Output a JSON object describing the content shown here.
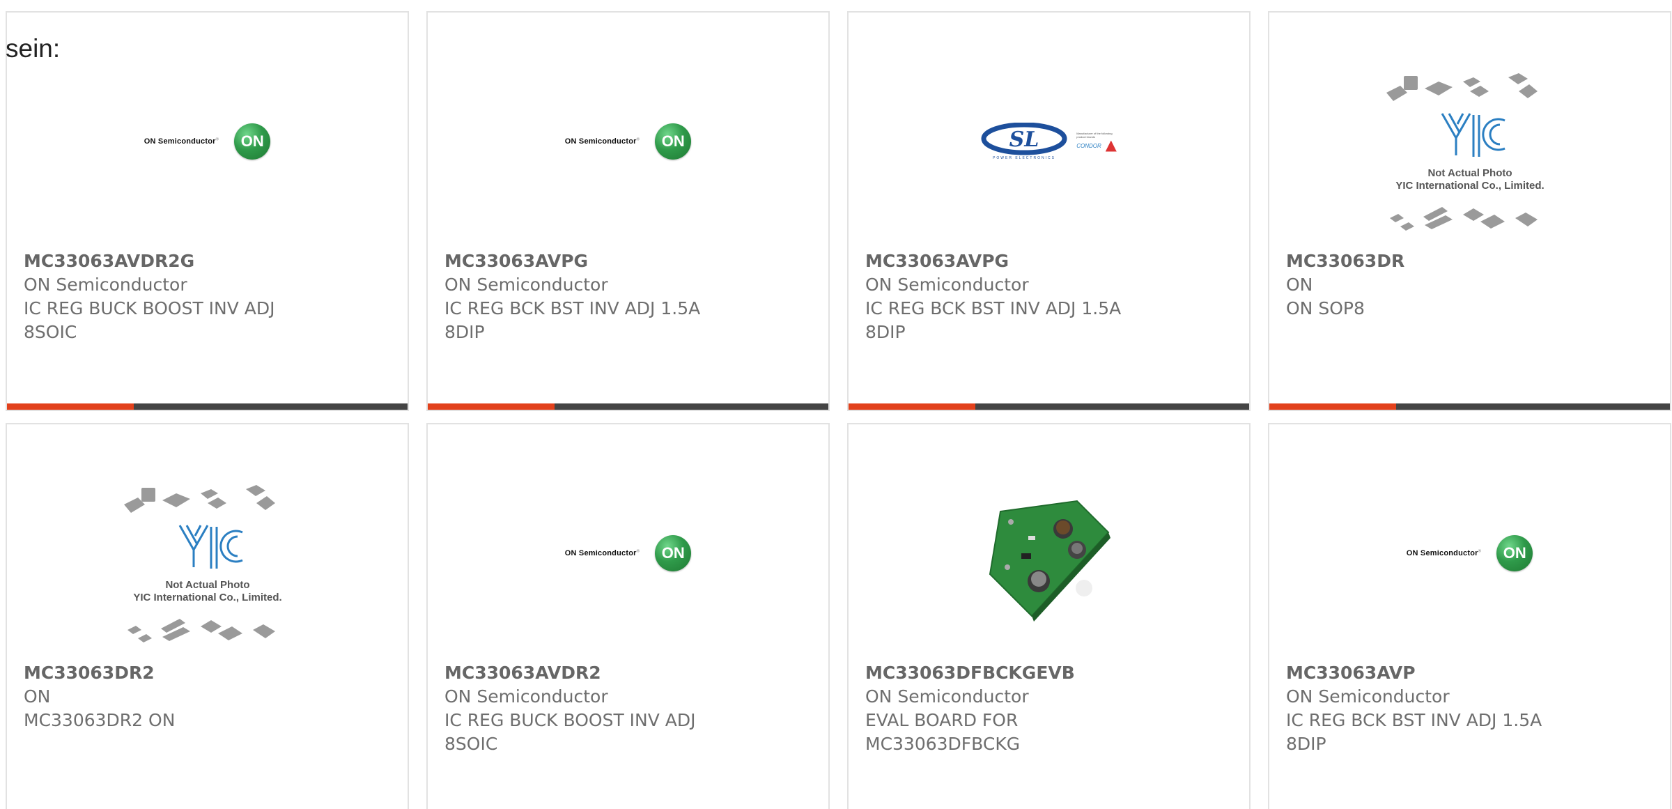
{
  "leading_text": "sein:",
  "colors": {
    "accent": "#e2411c",
    "bar": "#444444",
    "border": "#e2e2e2",
    "text": "#6e6e6e"
  },
  "products": [
    {
      "part": "MC33063AVDR2G",
      "maker": "ON Semiconductor",
      "desc": [
        "IC REG BUCK BOOST INV ADJ",
        "8SOIC"
      ],
      "image": "on-semiconductor-logo",
      "accent_bar": true
    },
    {
      "part": "MC33063AVPG",
      "maker": "ON Semiconductor",
      "desc": [
        "IC REG BCK BST INV ADJ 1.5A",
        "8DIP"
      ],
      "image": "on-semiconductor-logo",
      "accent_bar": true
    },
    {
      "part": "MC33063AVPG",
      "maker": "ON Semiconductor",
      "desc": [
        "IC REG BCK BST INV ADJ 1.5A",
        "8DIP"
      ],
      "image": "sl-power-electronics-logo",
      "accent_bar": true
    },
    {
      "part": "MC33063DR",
      "maker": "ON",
      "desc": [
        "ON SOP8",
        ""
      ],
      "image": "yic-placeholder",
      "accent_bar": true
    },
    {
      "part": "MC33063DR2",
      "maker": "ON",
      "desc": [
        "MC33063DR2 ON",
        ""
      ],
      "image": "yic-placeholder",
      "accent_bar": false
    },
    {
      "part": "MC33063AVDR2",
      "maker": "ON Semiconductor",
      "desc": [
        "IC REG BUCK BOOST INV ADJ",
        "8SOIC"
      ],
      "image": "on-semiconductor-logo",
      "accent_bar": false
    },
    {
      "part": "MC33063DFBCKGEVB",
      "maker": "ON Semiconductor",
      "desc": [
        "EVAL BOARD FOR",
        "MC33063DFBCKG"
      ],
      "image": "eval-board-photo",
      "accent_bar": false
    },
    {
      "part": "MC33063AVP",
      "maker": "ON Semiconductor",
      "desc": [
        "IC REG BCK BST INV ADJ 1.5A",
        "8DIP"
      ],
      "image": "on-semiconductor-logo",
      "accent_bar": false
    }
  ],
  "logos": {
    "on_brand": "ON Semiconductor",
    "on_disc": "ON",
    "sl_letters": "SL",
    "sl_tag": "POWER ELECTRONICS",
    "sl_side": "Manufacturer of the following product brands",
    "sl_condor": "CONDOR",
    "yic_line1": "Not Actual Photo",
    "yic_line2": "YIC International Co., Limited."
  }
}
